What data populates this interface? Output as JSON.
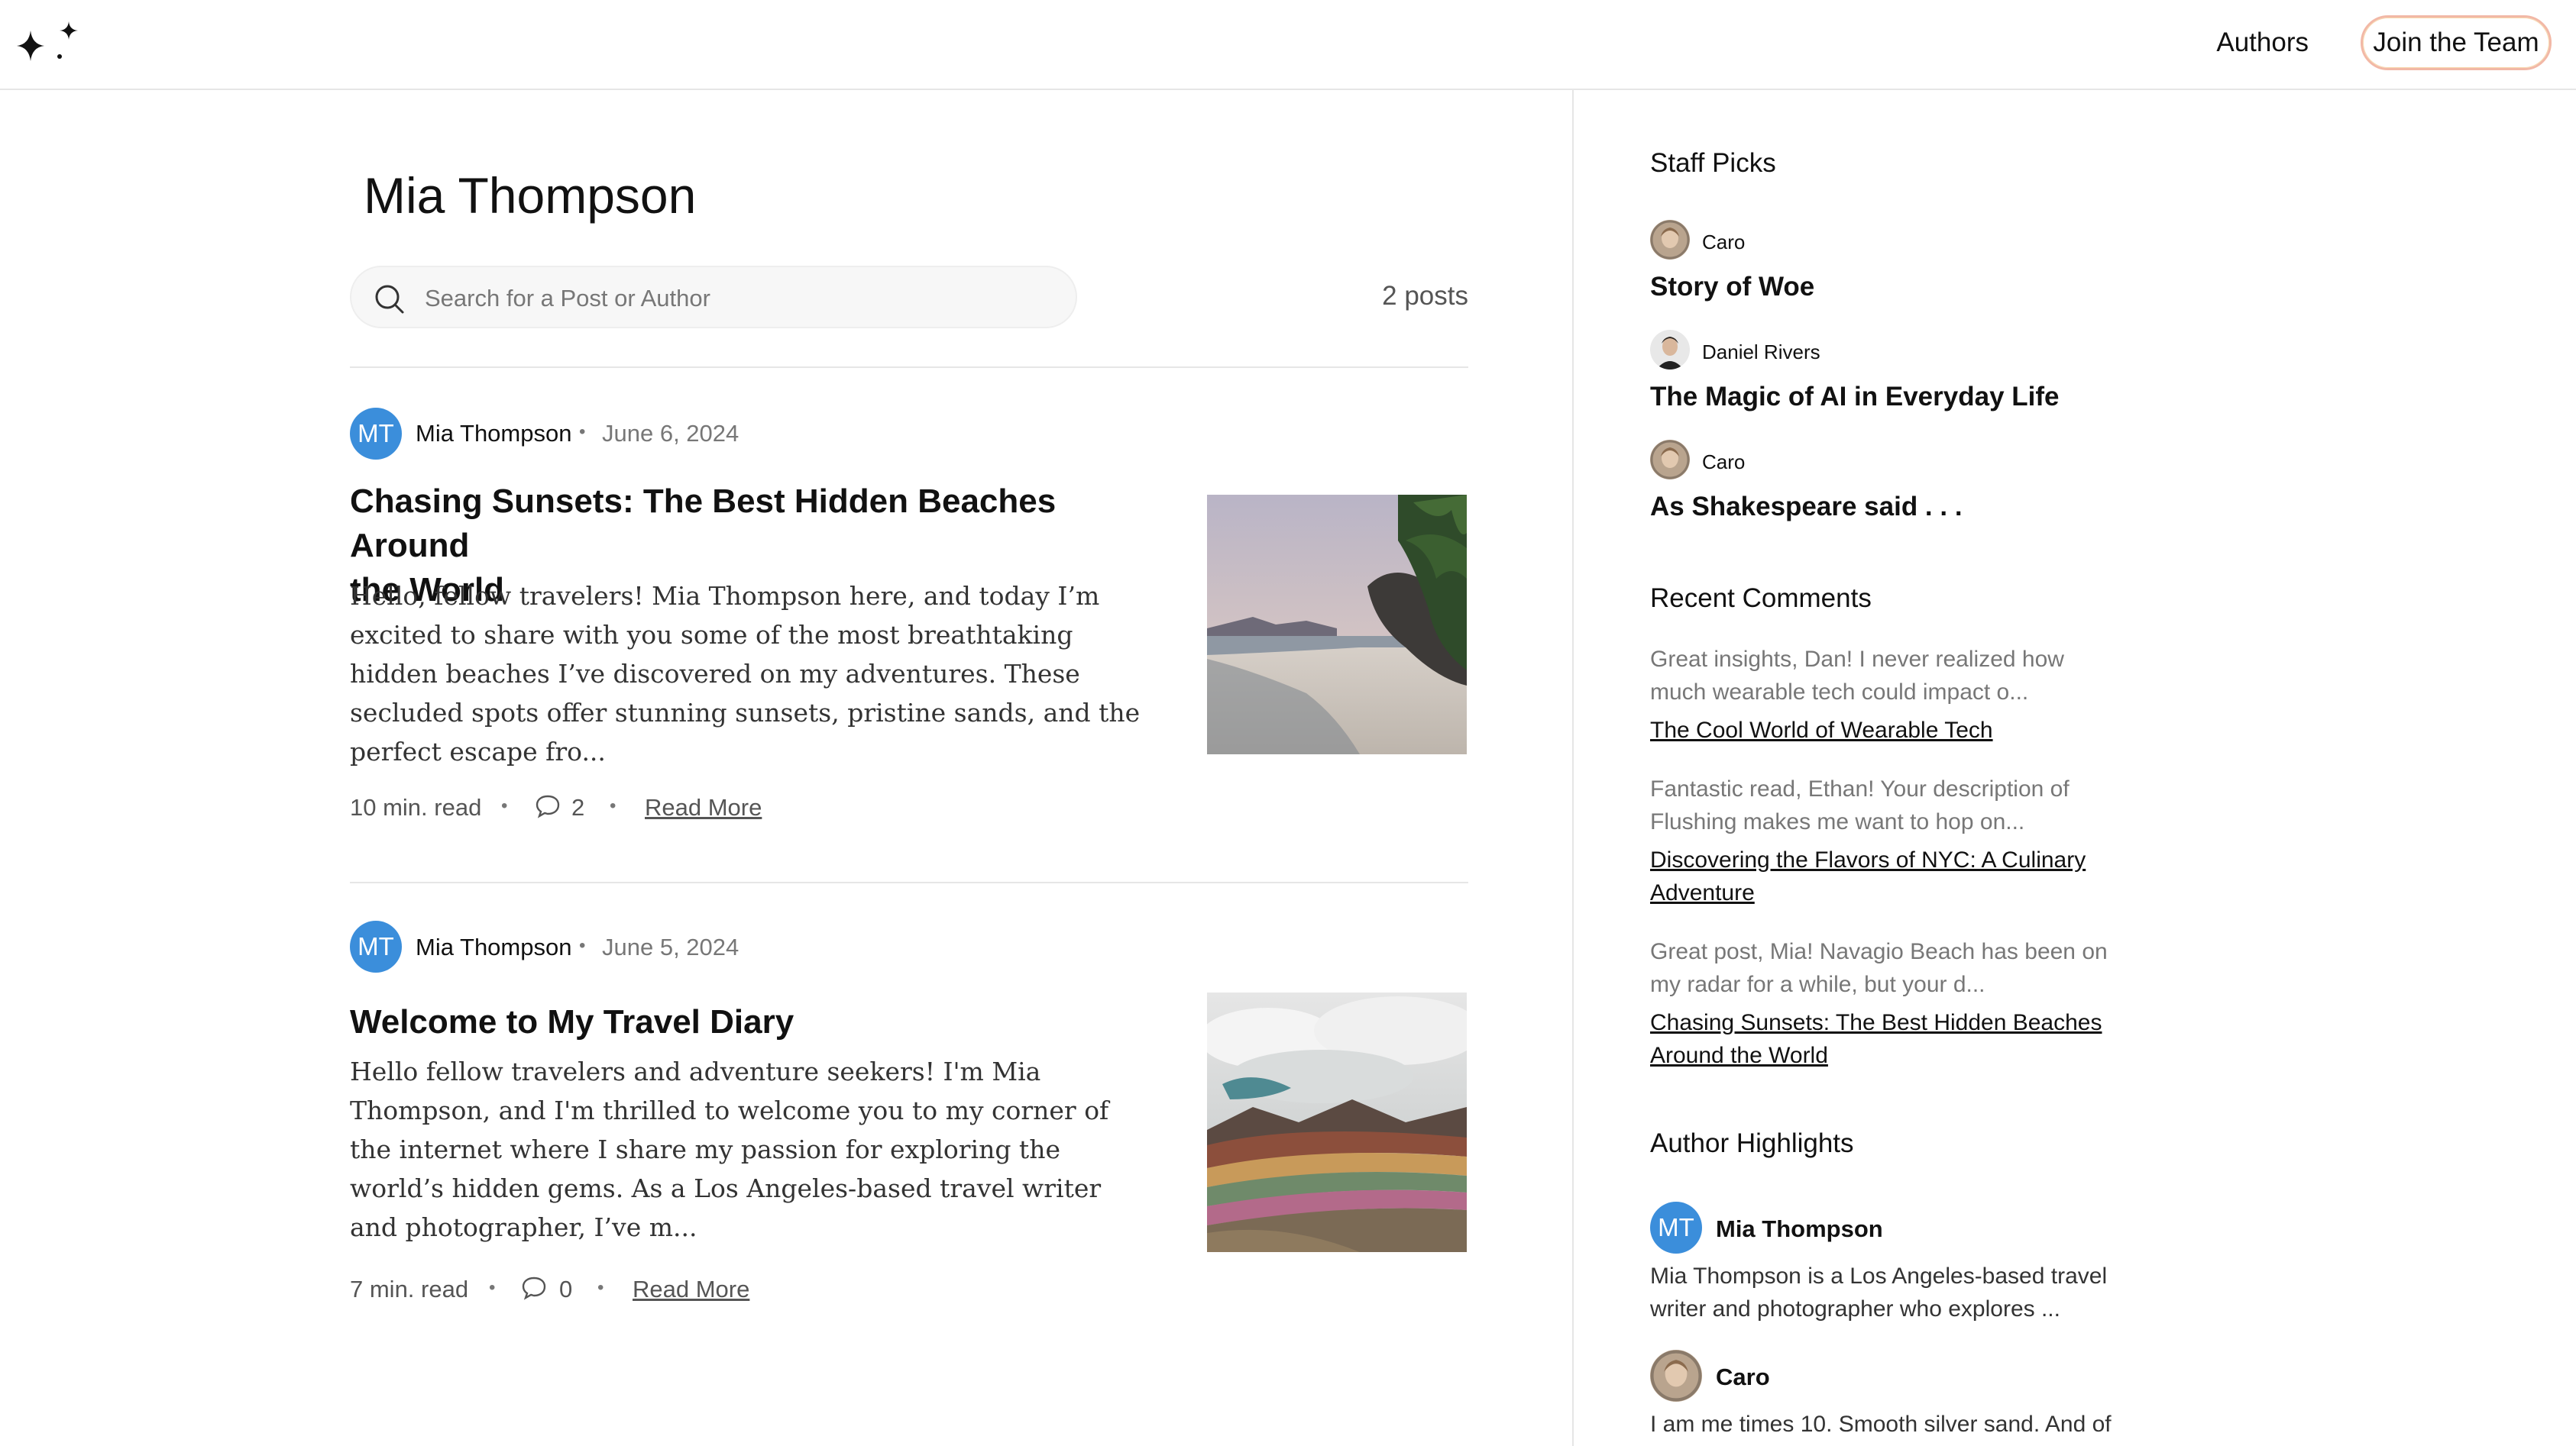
{
  "header": {
    "logo_icon": "sparkles-icon",
    "nav_authors": "Authors",
    "join_button": "Join the Team"
  },
  "main": {
    "title": "Mia Thompson",
    "search_placeholder": "Search for a Post or Author",
    "post_count": "2 posts",
    "posts": [
      {
        "avatar_initials": "MT",
        "author": "Mia Thompson",
        "date": "June 6, 2024",
        "title_line1": "Chasing Sunsets: The Best Hidden Beaches Around",
        "title_line2": "the World",
        "excerpt": "Hello, fellow travelers! Mia Thompson here, and today I’m excited to share with you some of the most breathtaking hidden beaches I’ve discovered on my adventures. These secluded spots offer stunning sunsets, pristine sands, and the perfect escape fro...",
        "read_time": "10 min. read",
        "comments": "2",
        "read_more": "Read More"
      },
      {
        "avatar_initials": "MT",
        "author": "Mia Thompson",
        "date": "June 5, 2024",
        "title_line1": "Welcome to My Travel Diary",
        "excerpt": "Hello fellow travelers and adventure seekers! I'm Mia Thompson, and I'm thrilled to welcome you to my corner of the internet where I share my passion for exploring the world’s hidden gems. As a Los Angeles-based travel writer and photographer, I’ve m...",
        "read_time": "7 min. read",
        "comments": "0",
        "read_more": "Read More"
      }
    ]
  },
  "sidebar": {
    "staff_picks_heading": "Staff Picks",
    "staff_picks": [
      {
        "author": "Caro",
        "title": "Story of Woe"
      },
      {
        "author": "Daniel Rivers",
        "title": "The Magic of AI in Everyday Life"
      },
      {
        "author": "Caro",
        "title": "As Shakespeare said . . ."
      }
    ],
    "recent_comments_heading": "Recent Comments",
    "recent_comments": [
      {
        "text": "Great insights, Dan! I never realized how much wearable tech could impact o...",
        "link": "The Cool World of Wearable Tech"
      },
      {
        "text": "Fantastic read, Ethan! Your description of Flushing makes me want to hop on...",
        "link": "Discovering the Flavors of NYC: A Culinary Adventure"
      },
      {
        "text": "Great post, Mia! Navagio Beach has been on my radar for a while, but your d...",
        "link": "Chasing Sunsets: The Best Hidden Beaches Around the World"
      }
    ],
    "highlights_heading": "Author Highlights",
    "highlights": [
      {
        "initials": "MT",
        "name": "Mia Thompson",
        "bio": "Mia Thompson is a Los Angeles-based travel writer and photographer who explores ..."
      },
      {
        "name": "Caro",
        "bio": "I am me times 10. Smooth silver sand. And of"
      }
    ]
  },
  "colors": {
    "accent_avatar": "#3b8edb",
    "border": "#e6e6e6",
    "join_border": "#f2b8a6"
  }
}
